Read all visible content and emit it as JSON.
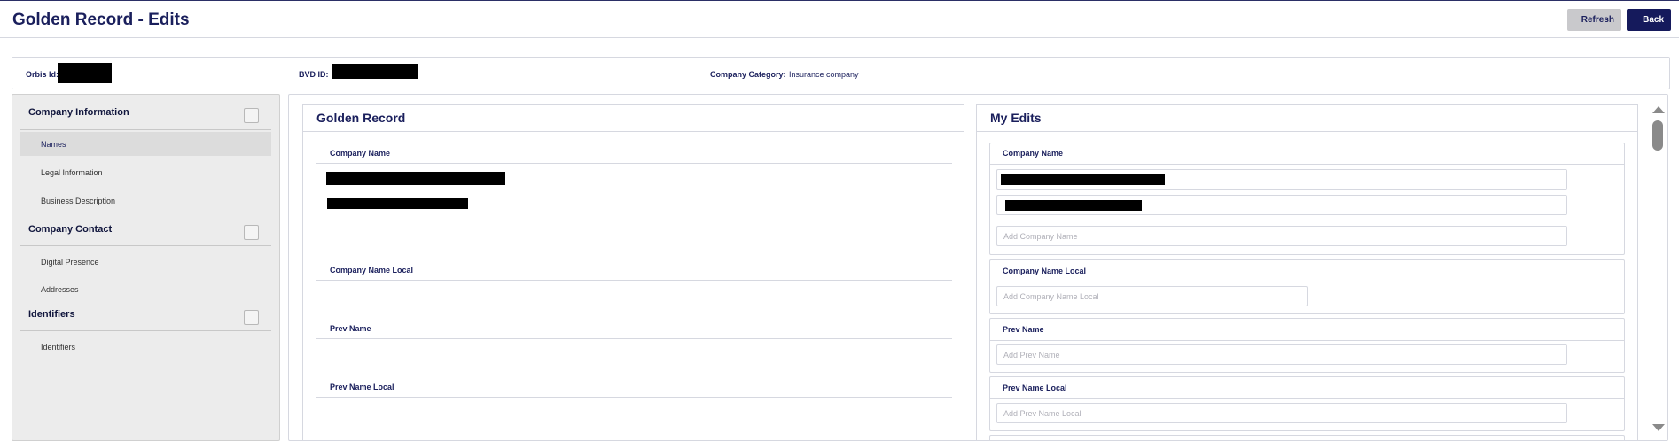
{
  "header": {
    "title": "Golden Record - Edits",
    "refresh_label": "Refresh",
    "back_label": "Back"
  },
  "info": {
    "orbis_label": "Orbis Id:",
    "bvd_label": "BVD ID:",
    "category_label": "Company Category:",
    "category_value": "Insurance company"
  },
  "sidebar": {
    "sections": [
      {
        "title": "Company Information",
        "items": [
          "Names",
          "Legal Information",
          "Business Description"
        ]
      },
      {
        "title": "Company Contact",
        "items": [
          "Digital Presence",
          "Addresses"
        ]
      },
      {
        "title": "Identifiers",
        "items": [
          "Identifiers"
        ]
      }
    ],
    "active_item": "Names"
  },
  "golden_record": {
    "title": "Golden Record",
    "fields": [
      "Company Name",
      "Company Name Local",
      "Prev Name",
      "Prev Name Local"
    ]
  },
  "my_edits": {
    "title": "My Edits",
    "fields": [
      "Company Name",
      "Company Name Local",
      "Prev Name",
      "Prev Name Local"
    ],
    "placeholders": {
      "company_name": "Add Company Name",
      "company_name_local": "Add Company Name Local",
      "prev_name": "Add Prev Name",
      "prev_name_local": "Add Prev Name Local"
    }
  },
  "colors": {
    "accent": "#1a1f5c",
    "back_button": "#151a5c",
    "refresh_button": "#c9c9cc",
    "sidebar_bg": "#ececec",
    "redaction": "#000000"
  }
}
